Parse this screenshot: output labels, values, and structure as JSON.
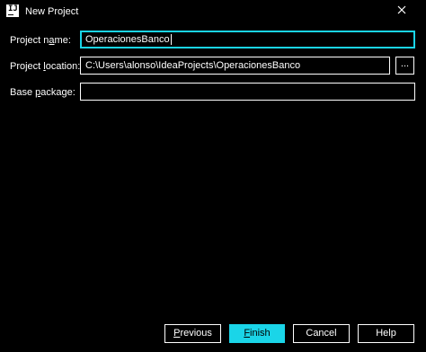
{
  "window": {
    "title": "New Project",
    "accent_color": "#1ad5e8",
    "icon": "intellij-idea-icon",
    "close_icon": "close-icon"
  },
  "form": {
    "project_name": {
      "label_pre": "Project n",
      "label_mnemonic": "a",
      "label_post": "me:",
      "value": "OperacionesBanco"
    },
    "project_location": {
      "label_pre": "Project ",
      "label_mnemonic": "l",
      "label_post": "ocation:",
      "value": "C:\\Users\\alonso\\IdeaProjects\\OperacionesBanco",
      "browse_label": "..."
    },
    "base_package": {
      "label_pre": "Base ",
      "label_mnemonic": "p",
      "label_post": "ackage:",
      "value": ""
    }
  },
  "buttons": {
    "previous": {
      "mnemonic": "P",
      "rest": "revious"
    },
    "finish": {
      "mnemonic": "F",
      "rest": "inish"
    },
    "cancel": "Cancel",
    "help": "Help"
  }
}
